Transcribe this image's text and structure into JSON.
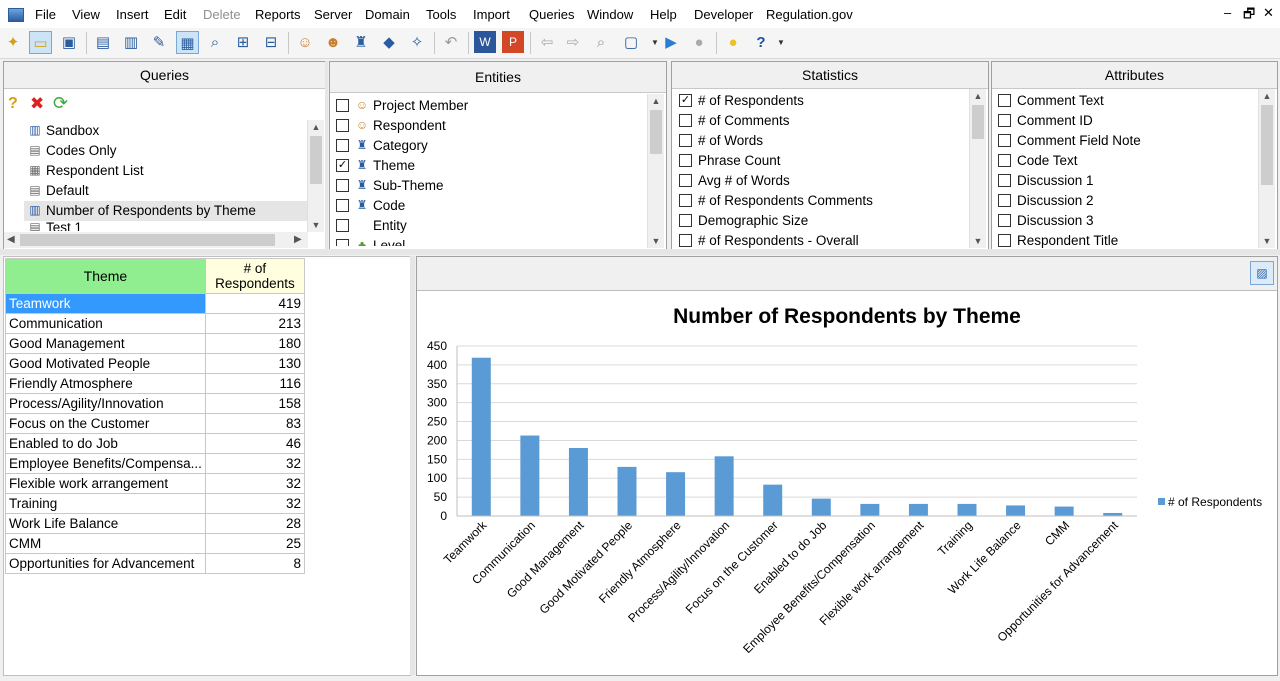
{
  "menu": [
    "File",
    "View",
    "Insert",
    "Edit",
    "Delete",
    "Reports",
    "Server",
    "Domain",
    "Tools",
    "Import",
    "Queries",
    "Window",
    "Help",
    "Developer",
    "Regulation.gov"
  ],
  "window_controls": [
    "–",
    "🗗",
    "✕"
  ],
  "panels": {
    "queries": {
      "title": "Queries",
      "items": [
        {
          "label": "Sandbox",
          "icon": "bar-chart-icon"
        },
        {
          "label": "Codes Only",
          "icon": "grid-icon"
        },
        {
          "label": "Respondent List",
          "icon": "table-icon"
        },
        {
          "label": "Default",
          "icon": "grid-icon"
        },
        {
          "label": "Number of Respondents by Theme",
          "icon": "bar-chart-icon",
          "selected": true
        },
        {
          "label": "Test 1",
          "icon": "grid-icon"
        }
      ]
    },
    "entities": {
      "title": "Entities",
      "items": [
        {
          "label": "Project Member",
          "checked": false,
          "icon": "person-icon"
        },
        {
          "label": "Respondent",
          "checked": false,
          "icon": "person-icon"
        },
        {
          "label": "Category",
          "checked": false,
          "icon": "bucket-icon"
        },
        {
          "label": "Theme",
          "checked": true,
          "icon": "bucket-icon"
        },
        {
          "label": "Sub-Theme",
          "checked": false,
          "icon": "bucket-icon"
        },
        {
          "label": "Code",
          "checked": false,
          "icon": "bucket-icon"
        },
        {
          "label": "Entity",
          "checked": false,
          "icon": ""
        },
        {
          "label": "Level",
          "checked": false,
          "icon": "level-icon"
        }
      ]
    },
    "statistics": {
      "title": "Statistics",
      "items": [
        {
          "label": "# of Respondents",
          "checked": true
        },
        {
          "label": "# of Comments",
          "checked": false
        },
        {
          "label": "# of Words",
          "checked": false
        },
        {
          "label": "Phrase Count",
          "checked": false
        },
        {
          "label": "Avg # of Words",
          "checked": false
        },
        {
          "label": "# of Respondents Comments",
          "checked": false
        },
        {
          "label": "Demographic Size",
          "checked": false
        },
        {
          "label": "# of Respondents - Overall",
          "checked": false
        }
      ]
    },
    "attributes": {
      "title": "Attributes",
      "items": [
        {
          "label": "Comment Text",
          "checked": false
        },
        {
          "label": "Comment ID",
          "checked": false
        },
        {
          "label": "Comment Field Note",
          "checked": false
        },
        {
          "label": "Code Text",
          "checked": false
        },
        {
          "label": "Discussion 1",
          "checked": false
        },
        {
          "label": "Discussion 2",
          "checked": false
        },
        {
          "label": "Discussion 3",
          "checked": false
        },
        {
          "label": "Respondent Title",
          "checked": false
        }
      ]
    }
  },
  "grid": {
    "headers": {
      "theme": "Theme",
      "count_line1": "# of",
      "count_line2": "Respondents"
    },
    "rows": [
      {
        "theme": "Teamwork",
        "count": "419",
        "selected": true
      },
      {
        "theme": "Communication",
        "count": "213"
      },
      {
        "theme": "Good Management",
        "count": "180"
      },
      {
        "theme": "Good Motivated People",
        "count": "130"
      },
      {
        "theme": "Friendly Atmosphere",
        "count": "116"
      },
      {
        "theme": "Process/Agility/Innovation",
        "count": "158"
      },
      {
        "theme": "Focus on the Customer",
        "count": "83"
      },
      {
        "theme": "Enabled to do Job",
        "count": "46"
      },
      {
        "theme": "Employee Benefits/Compensa...",
        "count": "32"
      },
      {
        "theme": "Flexible work arrangement",
        "count": "32"
      },
      {
        "theme": "Training",
        "count": "32"
      },
      {
        "theme": "Work Life Balance",
        "count": "28"
      },
      {
        "theme": "CMM",
        "count": "25"
      },
      {
        "theme": "Opportunities for Advancement",
        "count": "8"
      }
    ]
  },
  "chart_data": {
    "type": "bar",
    "title": "Number of Respondents by Theme",
    "categories": [
      "Teamwork",
      "Communication",
      "Good Management",
      "Good Motivated People",
      "Friendly Atmosphere",
      "Process/Agility/Innovation",
      "Focus on the Customer",
      "Enabled to do Job",
      "Employee Benefits/Compensation",
      "Flexible work arrangement",
      "Training",
      "Work Life Balance",
      "CMM",
      "Opportunities for Advancement"
    ],
    "series": [
      {
        "name": "# of Respondents",
        "values": [
          419,
          213,
          180,
          130,
          116,
          158,
          83,
          46,
          32,
          32,
          32,
          28,
          25,
          8
        ]
      }
    ],
    "ylim": [
      0,
      450
    ],
    "yticks": [
      0,
      50,
      100,
      150,
      200,
      250,
      300,
      350,
      400,
      450
    ],
    "grid": true,
    "legend": "right",
    "bar_color": "#5b9bd5"
  }
}
